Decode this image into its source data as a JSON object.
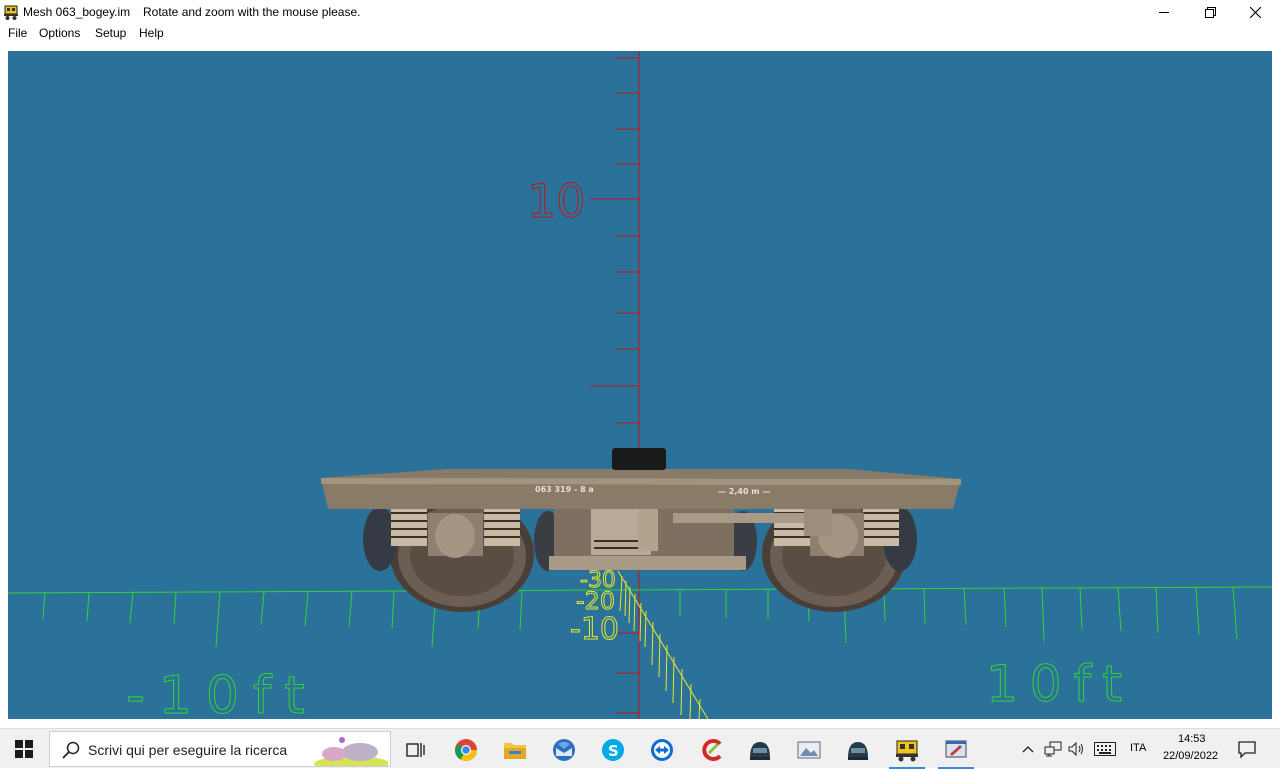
{
  "window": {
    "title": "Mesh 063_bogey.im",
    "message": "Rotate and zoom with the mouse please.",
    "app_icon": "bogey-app-icon",
    "controls": [
      "minimize-icon",
      "restore-icon",
      "close-icon"
    ]
  },
  "menu": {
    "file": "File",
    "options": "Options",
    "setup": "Setup",
    "help": "Help"
  },
  "viewport": {
    "background": "#2a7299",
    "vertical_axis_color": "#c0151b",
    "ground_axis_color": "#35d330",
    "depth_axis_color": "#e6e628",
    "labels": {
      "vertical_10": "10",
      "ground_left": "-10ft",
      "ground_right": "10ft",
      "depth_30": "-30",
      "depth_20": "-20",
      "depth_10": "-10"
    },
    "model": {
      "frame_text_left": "063 319 - 8 a",
      "frame_text_right": "— 2,40 m —",
      "frame_color": "#8a7b68",
      "wheel_color": "#6c5e52"
    }
  },
  "taskbar": {
    "search_placeholder": "Scrivi qui per eseguire la ricerca",
    "apps": [
      "task-view-icon",
      "chrome-icon",
      "file-explorer-icon",
      "thunderbird-icon",
      "skype-icon",
      "teamviewer-icon",
      "ccleaner-icon",
      "trainz-icon",
      "image-viewer-icon",
      "trainz-icon-2",
      "mesh-viewer-icon",
      "active-app-icon"
    ],
    "language": "ITA",
    "time": "14:53",
    "date": "22/09/2022"
  }
}
